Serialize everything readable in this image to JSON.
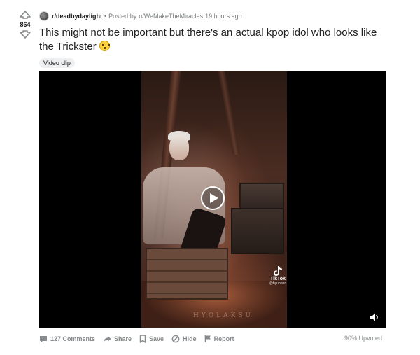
{
  "vote": {
    "count": "864",
    "upvote_icon": "arrow-up-icon",
    "downvote_icon": "arrow-down-icon"
  },
  "post": {
    "subreddit": "r/deadbydaylight",
    "posted_by": "Posted by",
    "author": "u/WeMakeTheMiracles",
    "time": "19 hours ago",
    "title": "This might not be important but there's an actual kpop idol who looks like the Trickster",
    "title_emoji": "flushed-face",
    "flair": "Video clip"
  },
  "video": {
    "play_icon": "play-icon",
    "volume_icon": "volume-icon",
    "tiktok_label": "TikTok",
    "tiktok_handle": "@hyunnnn",
    "watermark": "HYOLAKSU"
  },
  "actions": {
    "comments": "127 Comments",
    "share": "Share",
    "save": "Save",
    "hide": "Hide",
    "report": "Report",
    "upvoted": "90% Upvoted"
  },
  "colors": {
    "meta_text": "#787c7e",
    "action_text": "#878a8c",
    "flair_bg": "#edeff1",
    "video_bg": "#000000"
  }
}
